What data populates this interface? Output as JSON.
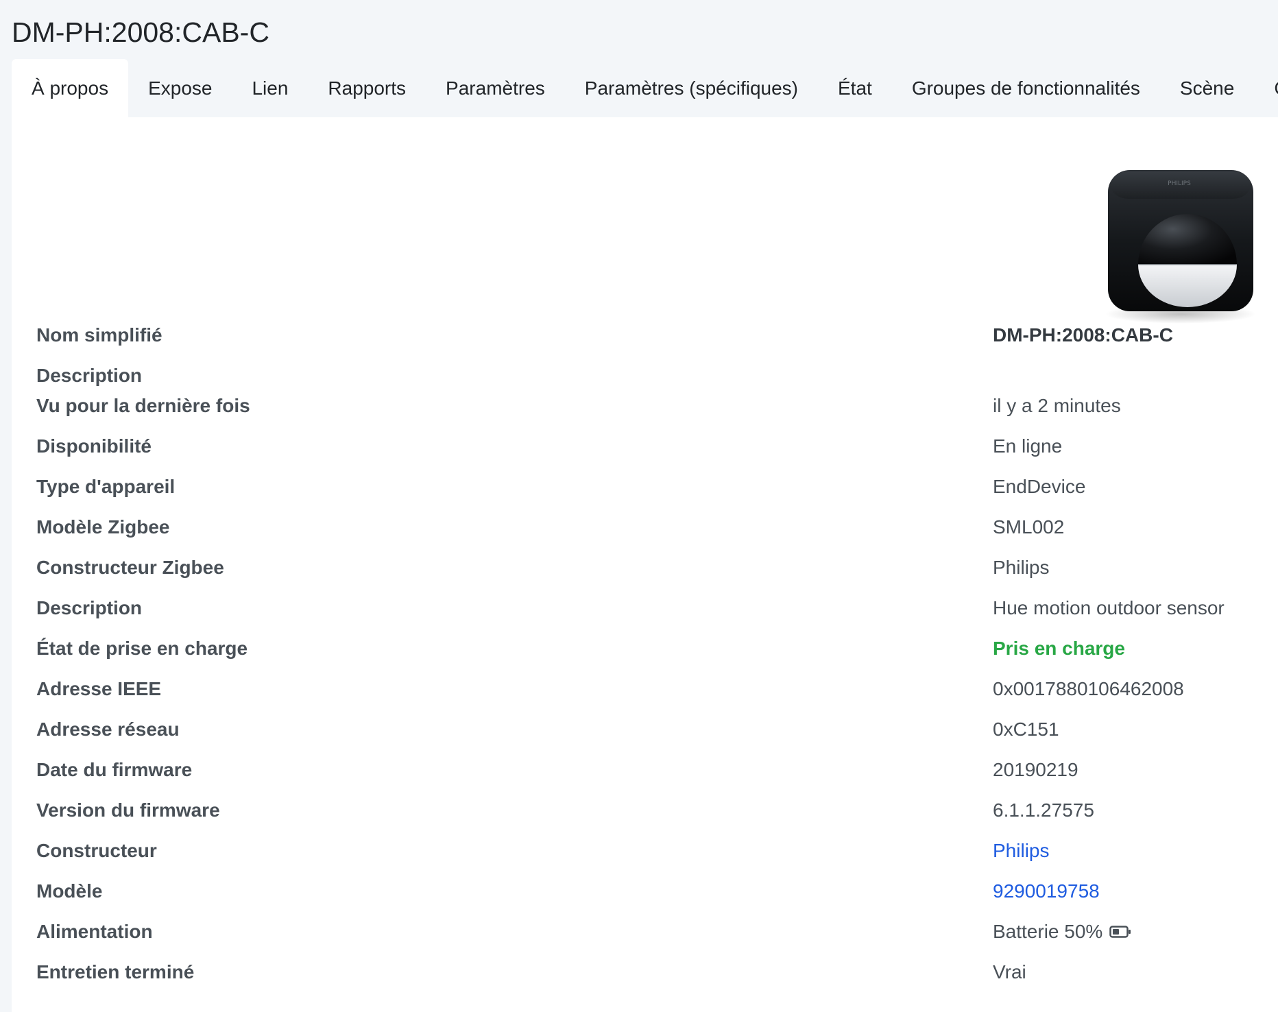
{
  "page_title": "DM-PH:2008:CAB-C",
  "tabs": [
    {
      "label": "À propos",
      "active": true
    },
    {
      "label": "Expose",
      "active": false
    },
    {
      "label": "Lien",
      "active": false
    },
    {
      "label": "Rapports",
      "active": false
    },
    {
      "label": "Paramètres",
      "active": false
    },
    {
      "label": "Paramètres (spécifiques)",
      "active": false
    },
    {
      "label": "État",
      "active": false
    },
    {
      "label": "Groupes de fonctionnalités",
      "active": false
    },
    {
      "label": "Scène",
      "active": false
    },
    {
      "label": "C",
      "active": false
    }
  ],
  "device": {
    "image_icon": "motion-sensor-photo",
    "image_brand_text": "PHILIPS"
  },
  "details": [
    {
      "label": "Nom simplifié",
      "value": "DM-PH:2008:CAB-C"
    },
    {
      "label": "Description",
      "value": ""
    },
    {
      "label": "Vu pour la dernière fois",
      "value": "il y a 2 minutes"
    },
    {
      "label": "Disponibilité",
      "value": "En ligne"
    },
    {
      "label": "Type d'appareil",
      "value": "EndDevice"
    },
    {
      "label": "Modèle Zigbee",
      "value": "SML002"
    },
    {
      "label": "Constructeur Zigbee",
      "value": "Philips"
    },
    {
      "label": "Description",
      "value": "Hue motion outdoor sensor"
    },
    {
      "label": "État de prise en charge",
      "value": "Pris en charge"
    },
    {
      "label": "Adresse IEEE",
      "value": "0x0017880106462008"
    },
    {
      "label": "Adresse réseau",
      "value": "0xC151"
    },
    {
      "label": "Date du firmware",
      "value": "20190219"
    },
    {
      "label": "Version du firmware",
      "value": "6.1.1.27575"
    },
    {
      "label": "Constructeur",
      "value": "Philips"
    },
    {
      "label": "Modèle",
      "value": "9290019758"
    },
    {
      "label": "Alimentation",
      "value": "Batterie 50%",
      "icon": "battery-half-icon",
      "battery_level": 0.5
    },
    {
      "label": "Entretien terminé",
      "value": "Vrai"
    }
  ],
  "colors": {
    "success": "#28a745",
    "link": "#1f5ce0",
    "text": "#495057",
    "background": "#f3f6f9",
    "panel": "#ffffff"
  }
}
